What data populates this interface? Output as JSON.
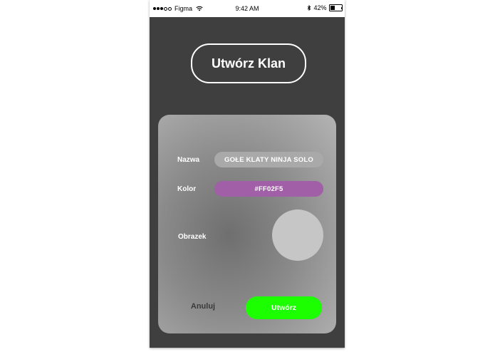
{
  "status_bar": {
    "carrier": "Figma",
    "time": "9:42 AM",
    "battery": "42%",
    "battery_level": 0.42
  },
  "header": {
    "title": "Utwórz Klan"
  },
  "form": {
    "name_label": "Nazwa",
    "name_value": "GOŁE KLATY NINJA SOLO",
    "color_label": "Kolor",
    "color_value": "#FF02F5",
    "image_label": "Obrazek"
  },
  "actions": {
    "cancel_label": "Anuluj",
    "create_label": "Utwórz"
  },
  "colors": {
    "background": "#3f3f3f",
    "accent_green": "#1cff00",
    "color_field": "#a05fa6",
    "name_field": "#a9a9a9"
  }
}
